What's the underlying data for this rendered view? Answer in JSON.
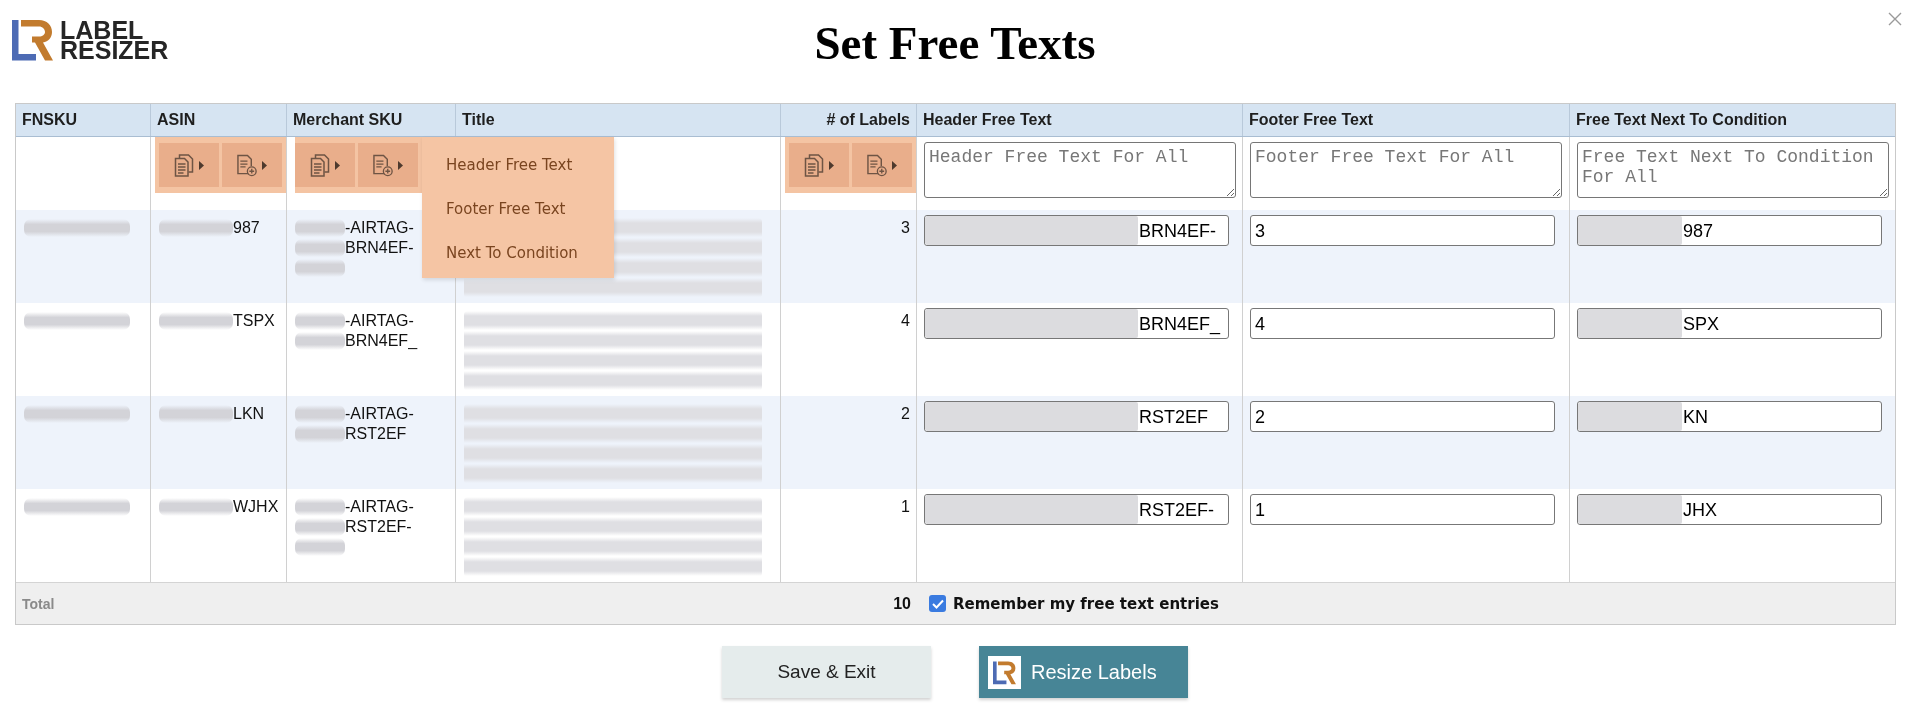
{
  "header": {
    "logo_text": "LABEL RESIZER",
    "title": "Set Free Texts"
  },
  "table": {
    "columns": [
      {
        "label": "FNSKU",
        "kind": "text"
      },
      {
        "label": "ASIN",
        "kind": "text",
        "bulk_buttons": {
          "highlighted": true
        }
      },
      {
        "label": "Merchant SKU",
        "kind": "text",
        "bulk_buttons": {
          "highlighted": true
        },
        "menu": {
          "expanded": true,
          "items": [
            "Header Free Text",
            "Footer Free Text",
            "Next To Condition"
          ]
        }
      },
      {
        "label": "Title",
        "kind": "text"
      },
      {
        "label": "# of Labels",
        "kind": "count",
        "bulk_buttons": {
          "highlighted": true
        }
      },
      {
        "label": "Header Free Text",
        "kind": "free_text",
        "placeholder": "Header Free Text For All"
      },
      {
        "label": "Footer Free Text",
        "kind": "free_text",
        "placeholder": "Footer Free Text For All"
      },
      {
        "label": "Free Text Next To Condition",
        "kind": "free_text",
        "placeholder": "Free Text Next To Condition For All"
      }
    ],
    "rows": [
      {
        "redacted": true,
        "asin": "987",
        "merchant_sku": [
          "-AIRTAG-",
          "BRN4EF-"
        ],
        "sku_tail_redacted": true,
        "labels": "3",
        "free_texts": [
          {
            "value": "BRN4EF-",
            "redacted": true
          },
          {
            "value": "3",
            "redacted": false
          },
          {
            "value": "987",
            "redacted": true
          }
        ]
      },
      {
        "redacted": true,
        "asin": "TSPX",
        "merchant_sku": [
          "-AIRTAG-",
          "BRN4EF_"
        ],
        "sku_tail_redacted": false,
        "labels": "4",
        "free_texts": [
          {
            "value": "BRN4EF_",
            "redacted": true
          },
          {
            "value": "4",
            "redacted": false
          },
          {
            "value": "SPX",
            "redacted": true
          }
        ]
      },
      {
        "redacted": true,
        "asin": "LKN",
        "merchant_sku": [
          "-AIRTAG-",
          "RST2EF"
        ],
        "sku_tail_redacted": false,
        "labels": "2",
        "free_texts": [
          {
            "value": "RST2EF",
            "redacted": true
          },
          {
            "value": "2",
            "redacted": false
          },
          {
            "value": "KN",
            "redacted": true
          }
        ]
      },
      {
        "redacted": true,
        "asin": "WJHX",
        "merchant_sku": [
          "-AIRTAG-",
          "RST2EF-"
        ],
        "sku_tail_redacted": true,
        "labels": "1",
        "free_texts": [
          {
            "value": "RST2EF-",
            "redacted": true
          },
          {
            "value": "1",
            "redacted": false
          },
          {
            "value": "JHX",
            "redacted": true
          }
        ]
      }
    ],
    "total": {
      "label": "Total",
      "labels": "10",
      "remember": {
        "label": "Remember my free text entries",
        "checked": true
      }
    }
  },
  "actions": [
    {
      "label": "Save & Exit",
      "kind": "secondary"
    },
    {
      "label": "Resize Labels",
      "kind": "primary"
    }
  ]
}
